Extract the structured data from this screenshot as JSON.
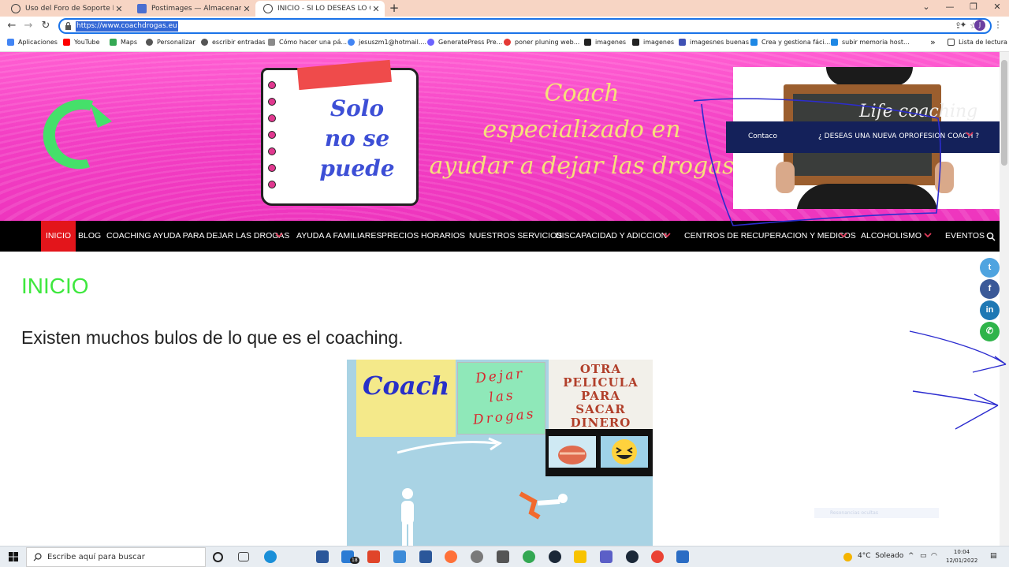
{
  "browser": {
    "tabs": [
      {
        "title": "Uso del Foro de Soporte Premium",
        "active": false
      },
      {
        "title": "Postimages — Almacenamiento de imágenes",
        "active": false
      },
      {
        "title": "INICIO - SI LO DESEAS LO CONSIGUES",
        "active": true
      }
    ],
    "new_tab": "+",
    "url": "https://www.coachdrogas.eu",
    "profile_initial": "J",
    "bookmarks": [
      {
        "label": "Aplicaciones",
        "color": "#4285f4"
      },
      {
        "label": "YouTube",
        "color": "#ff0000"
      },
      {
        "label": "Maps",
        "color": "#34a853"
      },
      {
        "label": "Personalizar",
        "color": "#555555"
      },
      {
        "label": "escribir entradas",
        "color": "#555555"
      },
      {
        "label": "Cómo hacer una pá...",
        "color": "#8a8a8a"
      },
      {
        "label": "jesuszm1@hotmail....",
        "color": "#4285f4"
      },
      {
        "label": "GeneratePress Pre...",
        "color": "#6c63ff"
      },
      {
        "label": "poner pluning web...",
        "color": "#e53935"
      },
      {
        "label": "imagenes",
        "color": "#222222"
      },
      {
        "label": "imagenes",
        "color": "#222222"
      },
      {
        "label": "imagesnes buenas",
        "color": "#3f51b5"
      },
      {
        "label": "Crea y gestiona fáci...",
        "color": "#1e88e5"
      },
      {
        "label": "subir memoria host...",
        "color": "#1e88e5"
      }
    ],
    "bookmarks_more": "»",
    "reading_list": "Lista de lectura"
  },
  "hero": {
    "note_lines": [
      "Solo",
      "no se",
      "puede"
    ],
    "tagline_lines": [
      "Coach",
      "especializado en",
      "ayudar a dejar las drogas"
    ],
    "board_text": "Life coaching",
    "dropdown": {
      "items": [
        "Contaco",
        "¿ DESEAS UNA NUEVA OPROFESION COACH ?"
      ]
    }
  },
  "nav": {
    "items": [
      {
        "label": "INICIO",
        "active": true,
        "has_submenu": false
      },
      {
        "label": "BLOG",
        "active": false,
        "has_submenu": false
      },
      {
        "label": "COACHING AYUDA PARA DEJAR LAS DROGAS",
        "active": false,
        "has_submenu": true
      },
      {
        "label": "AYUDA A FAMILIARES",
        "active": false,
        "has_submenu": false
      },
      {
        "label": "PRECIOS",
        "active": false,
        "has_submenu": false
      },
      {
        "label": "HORARIOS",
        "active": false,
        "has_submenu": false
      },
      {
        "label": "NUESTROS SERVICIOS",
        "active": false,
        "has_submenu": false
      },
      {
        "label": "DISCAPACIDAD Y ADICCION",
        "active": false,
        "has_submenu": true
      },
      {
        "label": "CENTROS DE RECUPERACION Y MEDICOS",
        "active": false,
        "has_submenu": true
      },
      {
        "label": "ALCOHOLISMO",
        "active": false,
        "has_submenu": true
      },
      {
        "label": "EVENTOS",
        "active": false,
        "has_submenu": false
      }
    ]
  },
  "content": {
    "page_title": "INICIO",
    "lead": "Existen muchos bulos de lo que es el coaching.",
    "image": {
      "sticky1": "Coach",
      "sticky2": "Dejar las Drogas",
      "sticky3_lines": [
        "OTRA",
        "PELICULA",
        "PARA",
        "SACAR",
        "DINERO"
      ]
    },
    "faint_bar_text": "Resonancias ocultas"
  },
  "social": [
    {
      "icon": "twitter-icon",
      "glyph": "t",
      "color": "#4fa4e0"
    },
    {
      "icon": "facebook-icon",
      "glyph": "f",
      "color": "#3b5998"
    },
    {
      "icon": "linkedin-icon",
      "glyph": "in",
      "color": "#1e78b4"
    },
    {
      "icon": "whatsapp-icon",
      "glyph": "✆",
      "color": "#2fb44a"
    }
  ],
  "taskbar": {
    "search_placeholder": "Escribe aquí para buscar",
    "mail_badge": "18",
    "weather": "4°C  Soleado",
    "time": "10:04",
    "date": "12/01/2022",
    "apps": [
      {
        "name": "cortana-icon",
        "color": "#222222"
      },
      {
        "name": "task-view-icon",
        "color": "#444444"
      },
      {
        "name": "edge-icon",
        "color": "#1a8fd8"
      },
      {
        "name": "store-icon",
        "color": "#2b579a"
      },
      {
        "name": "file-explorer-icon",
        "color": "#f2c043"
      },
      {
        "name": "mail-icon",
        "color": "#2b7bd4"
      },
      {
        "name": "office-icon",
        "color": "#e0452a"
      },
      {
        "name": "app-icon",
        "color": "#3d8bd8"
      },
      {
        "name": "word-icon",
        "color": "#2b579a"
      },
      {
        "name": "firefox-icon",
        "color": "#ff7139"
      },
      {
        "name": "app2-icon",
        "color": "#7a7a7a"
      },
      {
        "name": "calculator-icon",
        "color": "#555555"
      },
      {
        "name": "chrome-icon",
        "color": "#34a853"
      },
      {
        "name": "steam-icon",
        "color": "#1b2838"
      },
      {
        "name": "notes-icon",
        "color": "#f8c300"
      },
      {
        "name": "teams-icon",
        "color": "#5b5fc7"
      },
      {
        "name": "steam2-icon",
        "color": "#1b2838"
      },
      {
        "name": "chrome2-icon",
        "color": "#ea4335"
      },
      {
        "name": "photos-icon",
        "color": "#2a6cc4"
      }
    ]
  }
}
